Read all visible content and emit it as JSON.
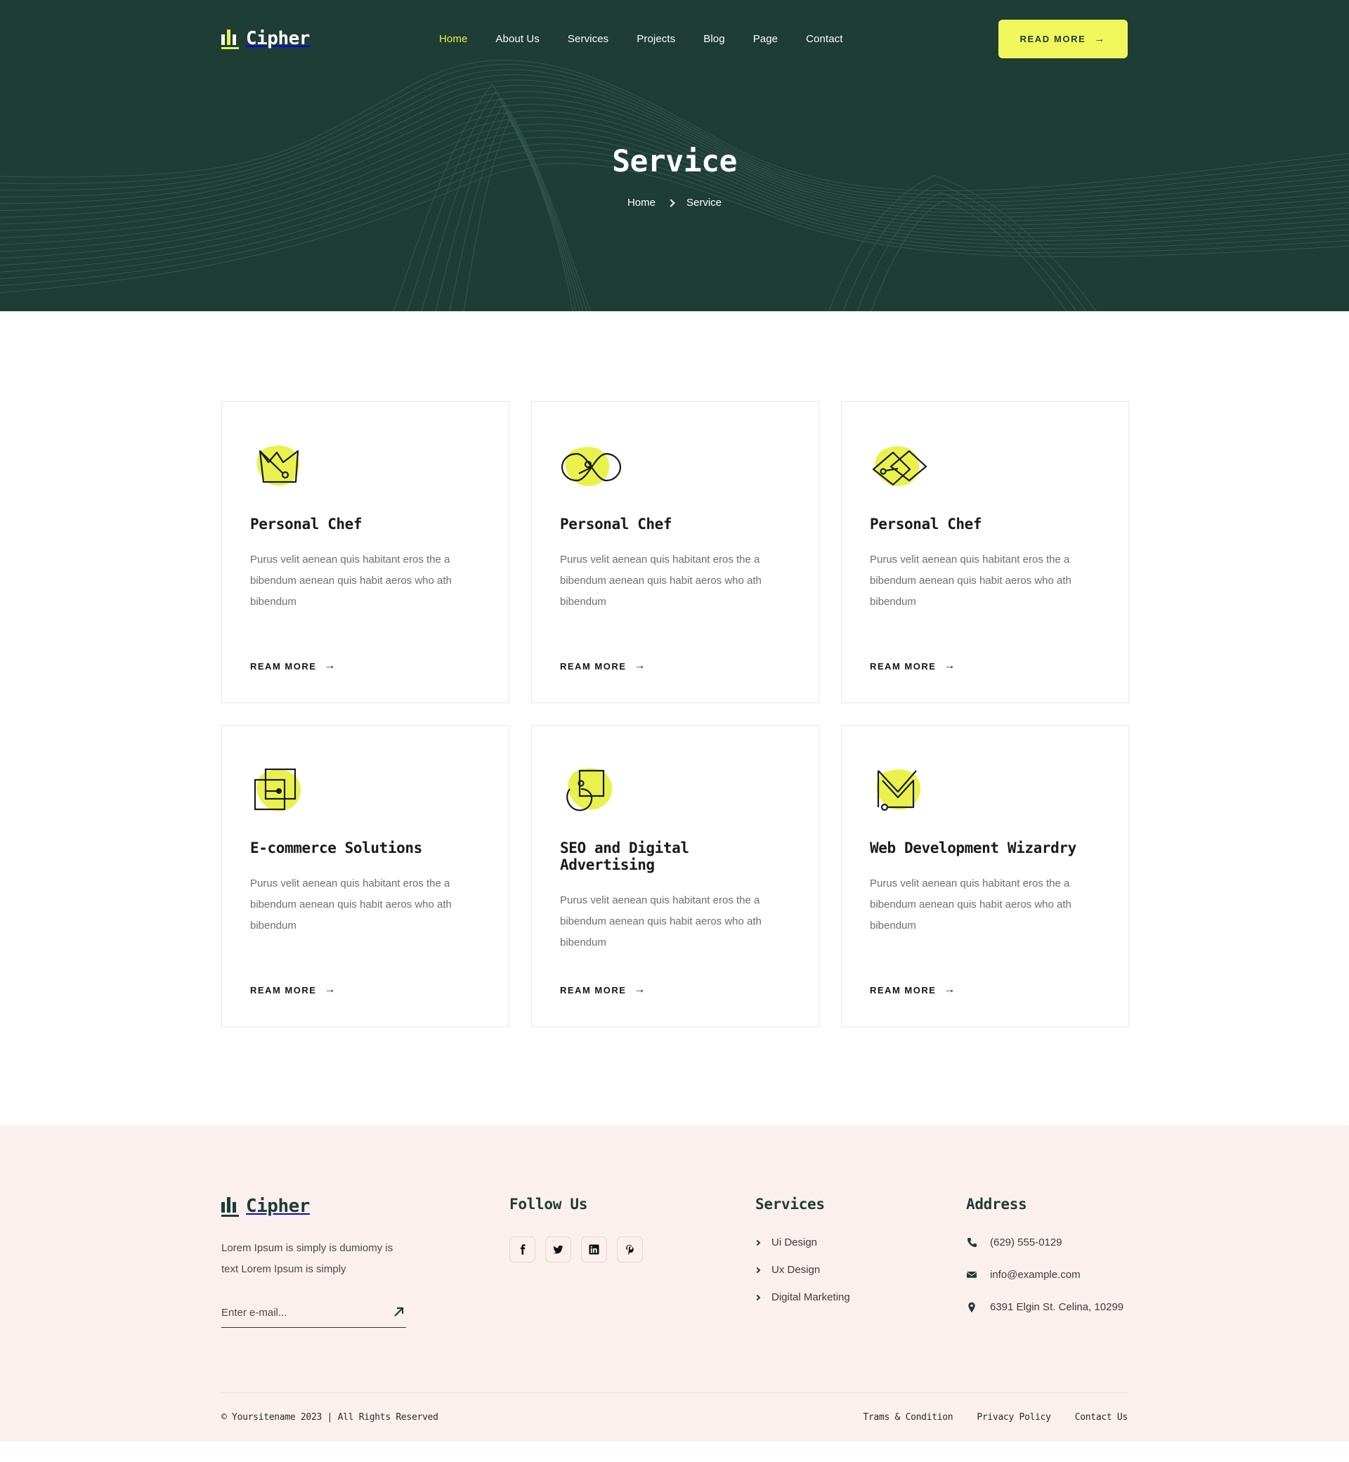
{
  "theme": {
    "dark_green": "#1d3d35",
    "accent_yellow": "#e9f24d",
    "button_yellow": "#f0f75c",
    "footer_pink": "#fcf0ee",
    "body_text": "#6e6e6e"
  },
  "header": {
    "brand": "Cipher",
    "nav": [
      {
        "label": "Home",
        "active": true
      },
      {
        "label": "About Us",
        "active": false
      },
      {
        "label": "Services",
        "active": false
      },
      {
        "label": "Projects",
        "active": false
      },
      {
        "label": "Blog",
        "active": false
      },
      {
        "label": "Page",
        "active": false
      },
      {
        "label": "Contact",
        "active": false
      }
    ],
    "cta_label": "READ MORE",
    "cta_arrow": "→"
  },
  "hero": {
    "title": "Service",
    "breadcrumb": {
      "home": "Home",
      "separator": "chevron-right-icon",
      "current": "Service"
    }
  },
  "services": {
    "link_label": "REAM MORE",
    "link_arrow": "→",
    "cards": [
      {
        "icon": "crown-icon",
        "title": "Personal Chef",
        "desc": "Purus velit aenean quis habitant eros the a bibendum aenean quis habit aeros who ath bibendum"
      },
      {
        "icon": "infinity-icon",
        "title": "Personal Chef",
        "desc": "Purus velit aenean quis habitant eros the a bibendum aenean quis habit aeros who ath bibendum"
      },
      {
        "icon": "overlapping-diamonds-icon",
        "title": "Personal Chef",
        "desc": "Purus velit aenean quis habitant eros the a bibendum aenean quis habit aeros who ath bibendum"
      },
      {
        "icon": "overlapping-squares-icon",
        "title": "E-commerce Solutions",
        "desc": "Purus velit aenean quis habitant eros the a bibendum aenean quis habit aeros who ath bibendum"
      },
      {
        "icon": "square-circle-icon",
        "title": "SEO and Digital Advertising",
        "desc": "Purus velit aenean quis habitant eros the a bibendum aenean quis habit aeros who ath bibendum"
      },
      {
        "icon": "envelope-chevron-icon",
        "title": "Web Development Wizardry",
        "desc": "Purus velit aenean quis habitant eros the a bibendum aenean quis habit aeros who ath bibendum"
      }
    ]
  },
  "footer": {
    "brand": "Cipher",
    "about": "Lorem Ipsum is simply is dumiomy is text Lorem Ipsum is simply",
    "subscribe": {
      "placeholder": "Enter e-mail...",
      "value": "",
      "button_icon": "arrow-up-right-icon"
    },
    "follow": {
      "heading": "Follow Us",
      "socials": [
        {
          "name": "facebook-icon",
          "label": "Facebook"
        },
        {
          "name": "twitter-icon",
          "label": "Twitter"
        },
        {
          "name": "linkedin-icon",
          "label": "LinkedIn"
        },
        {
          "name": "pinterest-icon",
          "label": "Pinterest"
        }
      ]
    },
    "services": {
      "heading": "Services",
      "items": [
        {
          "label": "Ui Design"
        },
        {
          "label": "Ux Design"
        },
        {
          "label": "Digital Marketing"
        }
      ]
    },
    "address": {
      "heading": "Address",
      "items": [
        {
          "icon": "phone-icon",
          "value": "(629) 555-0129"
        },
        {
          "icon": "mail-icon",
          "value": "info@example.com"
        },
        {
          "icon": "map-pin-icon",
          "value": "6391 Elgin St. Celina, 10299"
        }
      ]
    },
    "bottom": {
      "copyright": "© Yoursitename  2023 | All Rights Reserved",
      "links": [
        {
          "label": "Trams & Condition"
        },
        {
          "label": "Privacy Policy"
        },
        {
          "label": "Contact Us"
        }
      ]
    }
  }
}
